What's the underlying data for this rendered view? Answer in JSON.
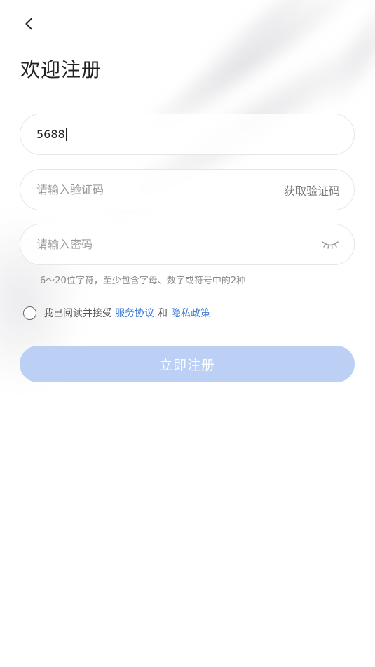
{
  "header": {
    "back_icon": "chevron-left-icon",
    "title": "欢迎注册"
  },
  "form": {
    "phone": {
      "value": "5688",
      "placeholder": ""
    },
    "code": {
      "placeholder": "请输入验证码",
      "get_code_label": "获取验证码"
    },
    "password": {
      "placeholder": "请输入密码",
      "toggle_icon": "eye-closed-icon"
    },
    "password_hint": "6～20位字符，至少包含字母、数字或符号中的2种"
  },
  "agreement": {
    "prefix": "我已阅读并接受",
    "service_link": "服务协议",
    "and": "和",
    "privacy_link": "隐私政策",
    "checked": false
  },
  "submit_label": "立即注册",
  "colors": {
    "accent": "#3a7bd5",
    "button_disabled": "#bcd0f5",
    "title": "#222222"
  }
}
